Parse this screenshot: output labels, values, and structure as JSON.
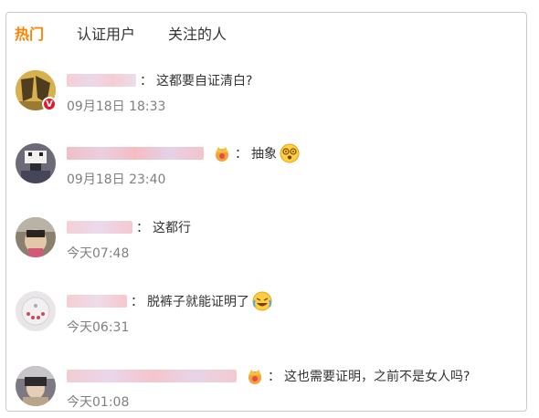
{
  "tabs": [
    {
      "label": "热门",
      "active": true
    },
    {
      "label": "认证用户",
      "active": false
    },
    {
      "label": "关注的人",
      "active": false
    }
  ],
  "comments": [
    {
      "text": "这都要自证清白?",
      "time": "09月18日 18:33",
      "verified_badge": "V",
      "crown": false,
      "emoji": ""
    },
    {
      "text": "抽象",
      "time": "09月18日 23:40",
      "crown": true,
      "emoji": "dizzy-face-emoji"
    },
    {
      "text": "这都行",
      "time": "今天07:48",
      "crown": false,
      "emoji": ""
    },
    {
      "text": "脱裤子就能证明了",
      "time": "今天06:31",
      "crown": false,
      "emoji": "laughing-crying-emoji"
    },
    {
      "text": "这也需要证明，之前不是女人吗?",
      "time": "今天01:08",
      "crown": true,
      "emoji": ""
    }
  ],
  "colors": {
    "accent": "#ff8200",
    "verified": "#e6162d",
    "timestamp": "#808080"
  }
}
